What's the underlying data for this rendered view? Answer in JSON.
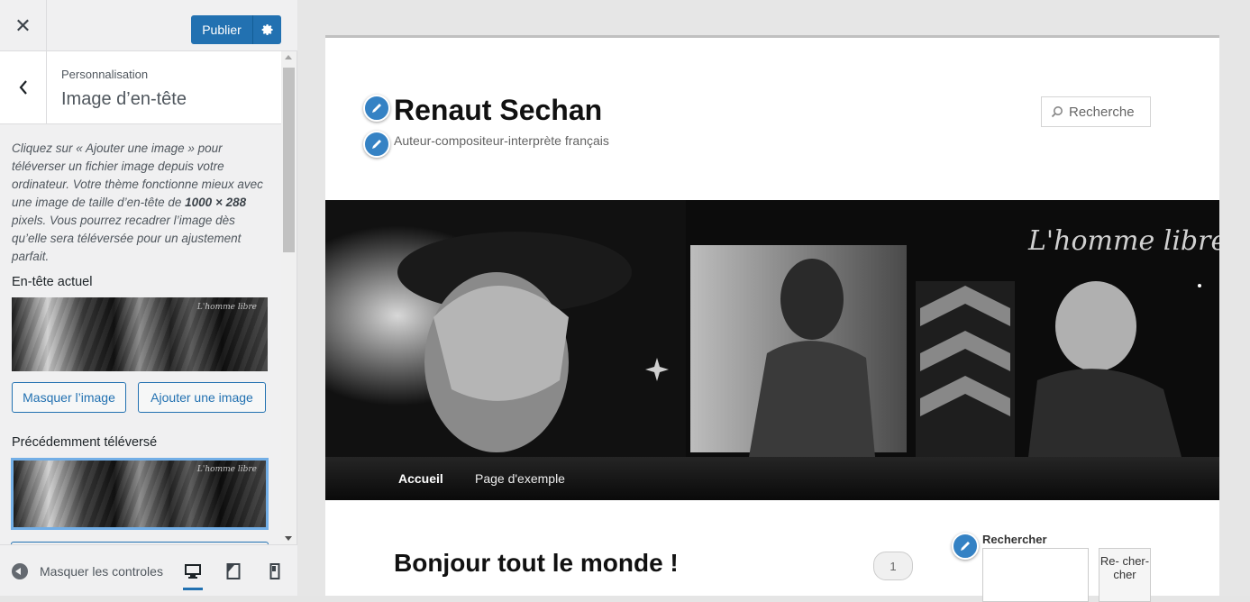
{
  "topbar": {
    "close_label": "✕",
    "publish_label": "Publier"
  },
  "section": {
    "breadcrumb": "Personnalisation",
    "title": "Image d’en-tête",
    "description_a": "Cliquez sur « Ajouter une image » pour téléverser un fichier image depuis votre ordinateur. Votre thème fonctionne mieux avec une image de taille d’en-tête de ",
    "width": "1000",
    "times": " × ",
    "height": "288",
    "description_b": " pixels. Vous pourrez recadrer l’image dès qu’elle sera téléversée pour un ajustement parfait.",
    "current_label": "En-tête actuel",
    "hide_button": "Masquer l’image",
    "add_button": "Ajouter une image",
    "previous_label": "Précédemment téléversé"
  },
  "footer": {
    "hide_controls": "Masquer les controles",
    "devices": [
      "desktop-icon",
      "tablet-icon",
      "mobile-icon"
    ]
  },
  "site": {
    "title": "Renaut Sechan",
    "tagline": "Auteur-compositeur-interprète français",
    "search_placeholder": "Recherche",
    "header_script": "L'homme libre",
    "nav": [
      "Accueil",
      "Page d'exemple"
    ],
    "post_title": "Bonjour tout le monde !",
    "comment_count": "1",
    "widget_title": "Rechercher",
    "widget_button": "Re- cher- cher"
  },
  "colors": {
    "accent": "#2271b1",
    "pencil": "#3582c4",
    "active_thumb_border": "#72aee6"
  }
}
